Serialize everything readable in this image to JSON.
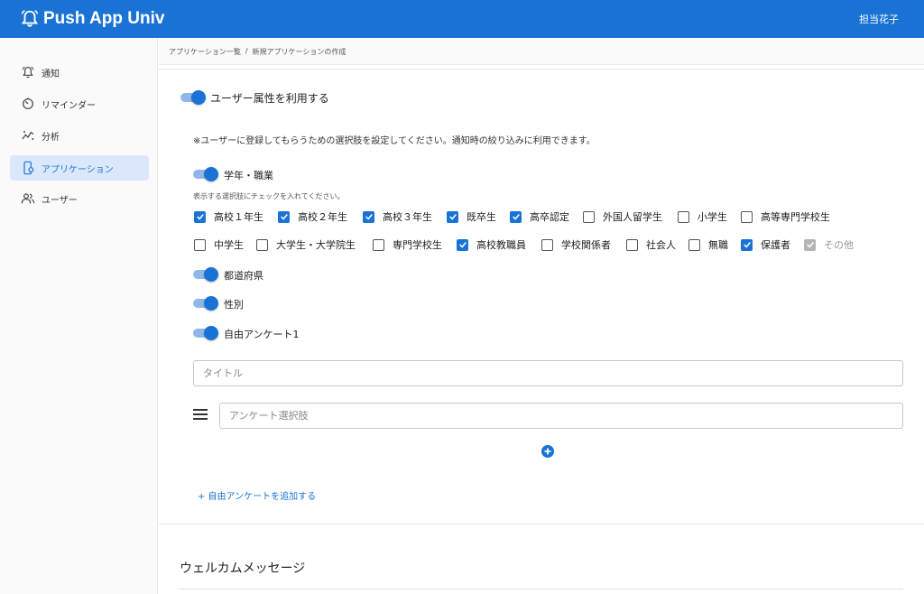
{
  "app": {
    "name": "Push App Univ",
    "user_name": "担当花子",
    "accent": "#1a73d4"
  },
  "sidebar": {
    "items": [
      {
        "label": "通知",
        "icon": "bell-icon"
      },
      {
        "label": "リマインダー",
        "icon": "timer-icon"
      },
      {
        "label": "分析",
        "icon": "analytics-icon"
      },
      {
        "label": "アプリケーション",
        "icon": "phone-settings-icon",
        "active": true
      },
      {
        "label": "ユーザー",
        "icon": "users-icon"
      }
    ]
  },
  "breadcrumb": {
    "items": [
      "アプリケーション一覧",
      "/",
      "新規アプリケーションの作成"
    ]
  },
  "attributes": {
    "main_toggle_label": "ユーザー属性を利用する",
    "main_toggle_on": true,
    "note": "※ユーザーに登録してもらうための選択肢を設定してください。通知時の絞り込みに利用できます。",
    "grade": {
      "label": "学年・職業",
      "on": true,
      "hint": "表示する選択肢にチェックを入れてください。",
      "options": [
        {
          "label": "高校１年生",
          "checked": true
        },
        {
          "label": "高校２年生",
          "checked": true
        },
        {
          "label": "高校３年生",
          "checked": true
        },
        {
          "label": "既卒生",
          "checked": true
        },
        {
          "label": "高卒認定",
          "checked": true
        },
        {
          "label": "外国人留学生",
          "checked": false
        },
        {
          "label": "小学生",
          "checked": false
        },
        {
          "label": "高等専門学校生",
          "checked": false
        },
        {
          "label": "中学生",
          "checked": false
        },
        {
          "label": "大学生・大学院生",
          "checked": false
        },
        {
          "label": "専門学校生",
          "checked": false
        },
        {
          "label": "高校教職員",
          "checked": true
        },
        {
          "label": "学校関係者",
          "checked": false
        },
        {
          "label": "社会人",
          "checked": false
        },
        {
          "label": "無職",
          "checked": false
        },
        {
          "label": "保護者",
          "checked": true
        },
        {
          "label": "その他",
          "checked": true,
          "disabled": true
        }
      ]
    },
    "prefecture": {
      "label": "都道府県",
      "on": true
    },
    "gender": {
      "label": "性別",
      "on": true
    },
    "survey": {
      "label": "自由アンケート1",
      "on": true,
      "title_placeholder": "タイトル",
      "choice_placeholder": "アンケート選択肢"
    },
    "add_survey_link": "+ 自由アンケートを追加する"
  },
  "welcome": {
    "title": "ウェルカムメッセージ"
  }
}
